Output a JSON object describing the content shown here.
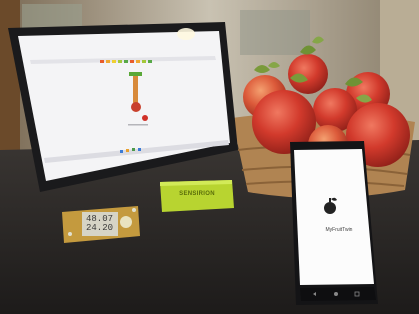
{
  "photo": {
    "description_objects": [
      "tablet",
      "basket-of-apples",
      "smartphone",
      "sensor-board",
      "brand-stand"
    ],
    "phone_app_name": "MyFruitTwin",
    "sensor_display_line1": "48.07",
    "sensor_display_line2": "24.20",
    "brand_stand_text": "SENSIRION",
    "colors": {
      "table": "#262321",
      "apple_red": "#c8342b",
      "stand_green": "#b8d430",
      "tablet_screen": "#f4f4f6"
    }
  }
}
